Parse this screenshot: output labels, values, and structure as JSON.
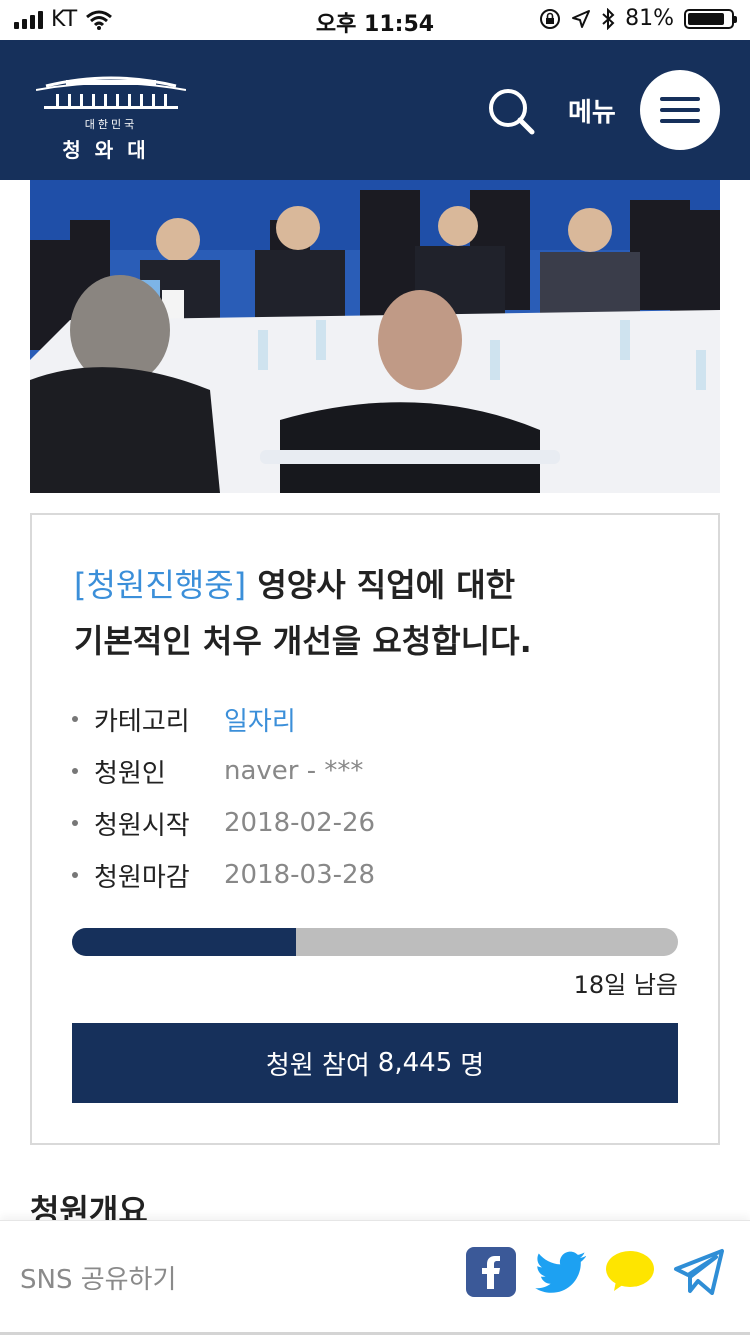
{
  "status_bar": {
    "carrier": "KT",
    "time": "오후 11:54",
    "battery_percent": "81%"
  },
  "header": {
    "logo_small": "대한민국",
    "logo_main": "청와대",
    "menu_label": "메뉴",
    "icons": [
      "search-icon",
      "hamburger-menu-icon"
    ]
  },
  "petition": {
    "status": "[청원진행중]",
    "title_line1": " 영양사 직업에 대한",
    "title_line2": "기본적인 처우 개선을 요청합니다.",
    "info": [
      {
        "label": "카테고리",
        "value": "일자리"
      },
      {
        "label": "청원인",
        "value": "naver - ***"
      },
      {
        "label": "청원시작",
        "value": "2018-02-26"
      },
      {
        "label": "청원마감",
        "value": "2018-03-28"
      }
    ],
    "progress_fraction": 0.37,
    "remaining": "18일 남음",
    "participate_prefix": "청원 참여",
    "participate_count": "8,445",
    "participate_suffix": "명"
  },
  "section": {
    "title": "청원개요"
  },
  "share": {
    "label": "SNS 공유하기",
    "icons": [
      "facebook-icon",
      "twitter-icon",
      "kakaotalk-icon",
      "telegram-icon"
    ]
  },
  "colors": {
    "navy": "#16305b",
    "accent_blue": "#3b8fd9",
    "facebook": "#3b5998",
    "twitter": "#1da1f2",
    "kakao": "#fee500",
    "telegram": "#2f8ed6"
  }
}
